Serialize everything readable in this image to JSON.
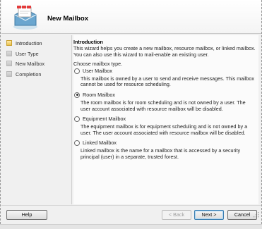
{
  "window": {
    "title": "New Mailbox"
  },
  "nav": {
    "items": [
      {
        "label": "Introduction",
        "active": true
      },
      {
        "label": "User Type",
        "active": false
      },
      {
        "label": "New Mailbox",
        "active": false
      },
      {
        "label": "Completion",
        "active": false
      }
    ]
  },
  "intro": {
    "heading": "Introduction",
    "description": "This wizard helps you create a new mailbox, resource mailbox, or linked mailbox. You can also use this wizard to mail-enable an existing user.",
    "prompt": "Choose mailbox type."
  },
  "options": [
    {
      "label": "User Mailbox",
      "checked": false,
      "description": "This mailbox is owned by a user to send and receive messages. This mailbox cannot be used for resource scheduling."
    },
    {
      "label": "Room Mailbox",
      "checked": true,
      "description": "The room mailbox is for room scheduling and is not owned by a user. The user account associated with resource mailbox will be disabled."
    },
    {
      "label": "Equipment Mailbox",
      "checked": false,
      "description": "The equipment mailbox is for equipment scheduling and is not owned by a user. The user account associated with resource mailbox will be disabled."
    },
    {
      "label": "Linked Mailbox",
      "checked": false,
      "description": "Linked mailbox is the name for a mailbox that is accessed by a security principal (user) in a separate, trusted forest."
    }
  ],
  "buttons": {
    "help": "Help",
    "back": "< Back",
    "next": "Next >",
    "cancel": "Cancel"
  },
  "icons": {
    "header": "new-mailbox-wizard-icon",
    "grip": "resize-grip-icon"
  }
}
